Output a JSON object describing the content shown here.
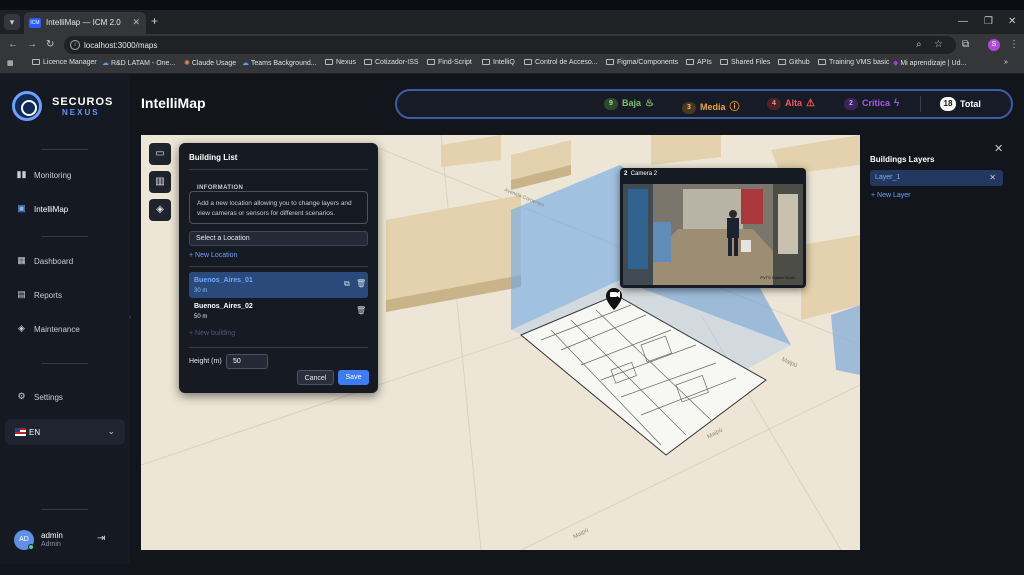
{
  "browser": {
    "tab_title": "IntelliMap — ICM 2.0",
    "tab_icon_text": "ICM",
    "url": "localhost:3000/maps",
    "profile_initial": "S",
    "bookmarks": [
      "Licence Manager",
      "R&D LATAM - One...",
      "Claude Usage",
      "Teams Background...",
      "Nexus",
      "Cotizador-ISS",
      "Find-Script",
      "IntelliQ",
      "Control de Acceso...",
      "Figma/Components",
      "APIs",
      "Shared Files",
      "Github",
      "Training VMS basic",
      "Mi aprendizaje | Ud..."
    ]
  },
  "app": {
    "logo_line1": "SECUROS",
    "logo_line2": "NEXUS",
    "page_title": "IntelliMap",
    "nav": {
      "monitoring": "Monitoring",
      "intellimap": "IntelliMap",
      "dashboard": "Dashboard",
      "reports": "Reports",
      "maintenance": "Maintenance",
      "settings": "Settings"
    },
    "language": "EN",
    "user": {
      "name": "admin",
      "role": "Admin",
      "initials": "AD"
    }
  },
  "alerts": {
    "baja": {
      "count": "9",
      "label": "Baja",
      "color": "#7cc36b"
    },
    "media": {
      "count": "3",
      "label": "Media",
      "color": "#f0a23a"
    },
    "alta": {
      "count": "4",
      "label": "Alta",
      "color": "#ef5a5a"
    },
    "critica": {
      "count": "2",
      "label": "Crítica",
      "color": "#a65af0"
    },
    "total": {
      "count": "18",
      "label": "Total"
    }
  },
  "building_list": {
    "title": "Building List",
    "info_legend": "INFORMATION",
    "info_text": "Add a new location allowing you to change layers and view cameras or sensors for different scenarios.",
    "select_location": "Select a Location",
    "new_location": "+ New Location",
    "buildings": [
      {
        "name": "Buenos_Aires_01",
        "height": "30 m"
      },
      {
        "name": "Buenos_Aires_02",
        "height": "50 m"
      }
    ],
    "new_building": "+ New building",
    "height_label": "Height (m)",
    "height_value": "50",
    "cancel": "Cancel",
    "save": "Save"
  },
  "camera": {
    "number": "2",
    "name": "Camera 2",
    "stamp": "PVTS Station Node"
  },
  "map_labels": {
    "street1": "Avenida Corrientes",
    "street2": "Maipú",
    "street3": "Maipú",
    "street4": "Maipú"
  },
  "layers": {
    "title": "Buildings Layers",
    "items": [
      "Layer_1"
    ],
    "new_layer": "+ New Layer"
  }
}
